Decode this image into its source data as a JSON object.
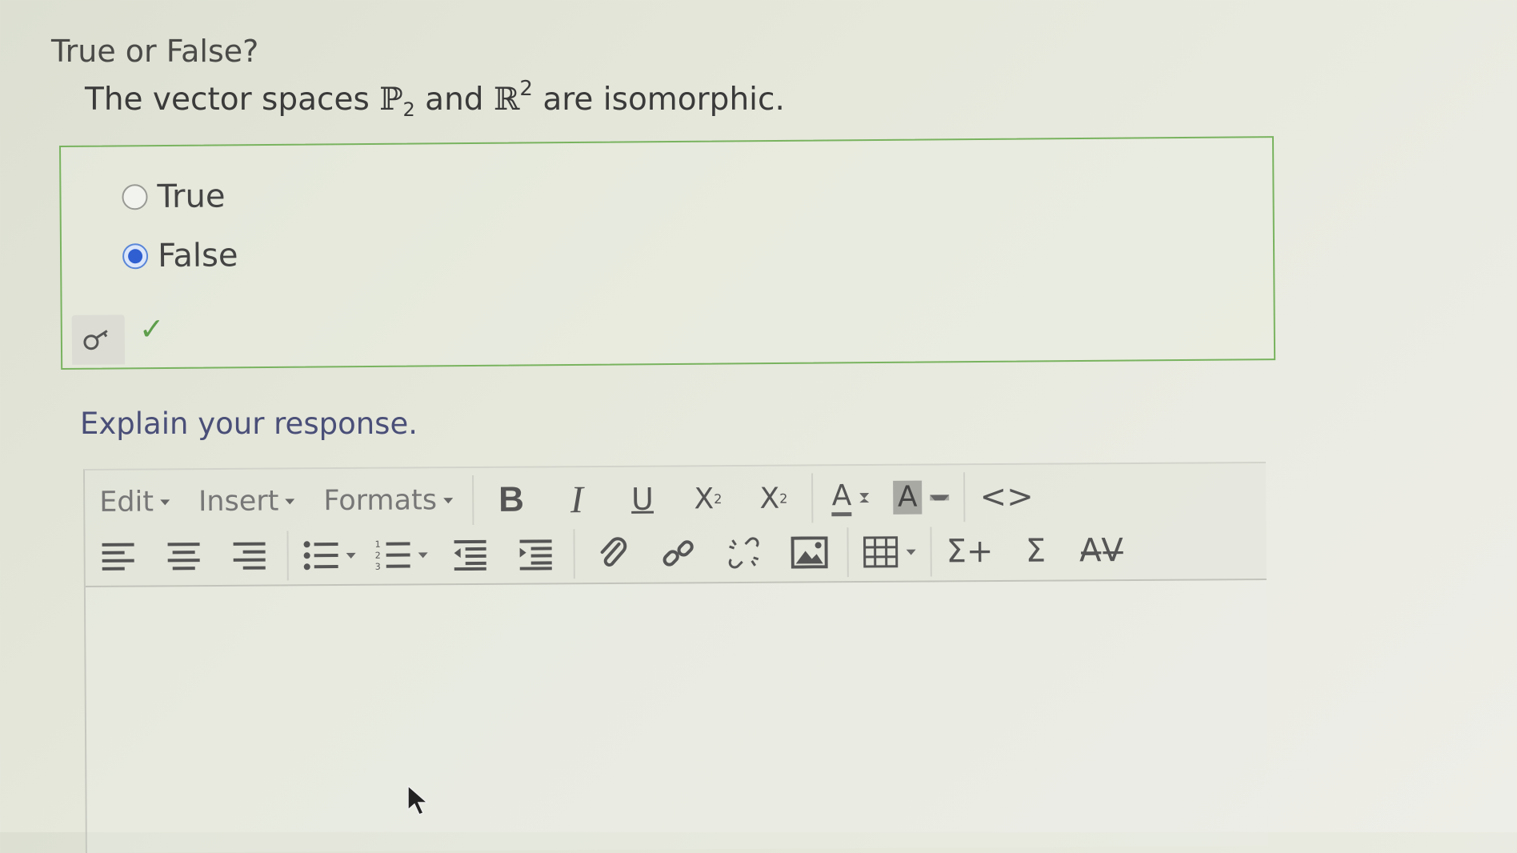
{
  "question": {
    "title": "True or False?",
    "statement_pre": "The vector spaces ",
    "p_symbol": "ℙ",
    "p_sub": "2",
    "and_text": " and ",
    "r_symbol": "ℝ",
    "r_sup": "2",
    "statement_post": " are isomorphic."
  },
  "choices": [
    {
      "label": "True",
      "selected": false
    },
    {
      "label": "False",
      "selected": true
    }
  ],
  "status": {
    "key_icon": "key-icon",
    "correct_icon": "checkmark-icon",
    "correct_color": "#5e9e4c"
  },
  "explain": {
    "prompt": "Explain your response."
  },
  "toolbar": {
    "menus": [
      "Edit",
      "Insert",
      "Formats"
    ],
    "bold": "B",
    "italic": "I",
    "underline": "U",
    "subscript": "X",
    "subscript_small": "2",
    "superscript": "X",
    "superscript_small": "2",
    "font_color": "A",
    "bg_color": "A",
    "code": "<>",
    "sigma_plus": "Σ+",
    "sigma": "Σ",
    "special_chars": "A̶V̶"
  },
  "colors": {
    "selected_radio": "#2f5fd0",
    "box_border": "#79b35f",
    "prompt_text": "#4a4f78"
  }
}
